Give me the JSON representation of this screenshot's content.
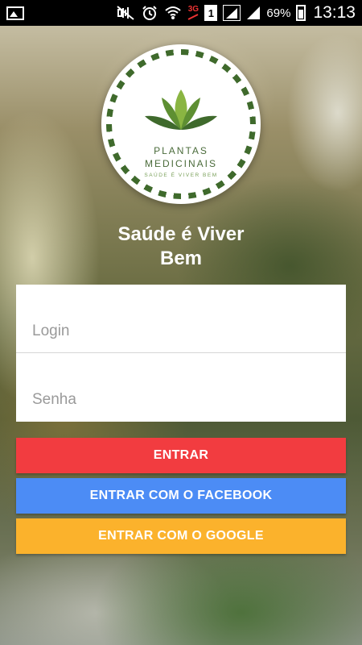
{
  "status_bar": {
    "battery_percent": "69%",
    "time": "13:13",
    "network_type": "3G",
    "sim_slot": "1",
    "icons": [
      "gallery-icon",
      "mute-icon",
      "alarm-icon",
      "wifi-icon",
      "3g-icon",
      "sim-icon",
      "signal-icon",
      "signal-icon",
      "battery-icon"
    ]
  },
  "logo": {
    "line1": "PLANTAS",
    "line2": "MEDICINAIS",
    "tagline": "SAÚDE É VIVER BEM"
  },
  "title": {
    "line1": "Saúde é Viver",
    "line2": "Bem"
  },
  "form": {
    "login_placeholder": "Login",
    "password_placeholder": "Senha"
  },
  "buttons": {
    "entrar": "ENTRAR",
    "facebook": "ENTRAR COM O FACEBOOK",
    "google": "ENTRAR COM O GOOGLE"
  },
  "colors": {
    "entrar": "#f23c40",
    "facebook": "#4c8cf5",
    "google": "#fbb22c",
    "logo_green": "#3f6a2c"
  }
}
